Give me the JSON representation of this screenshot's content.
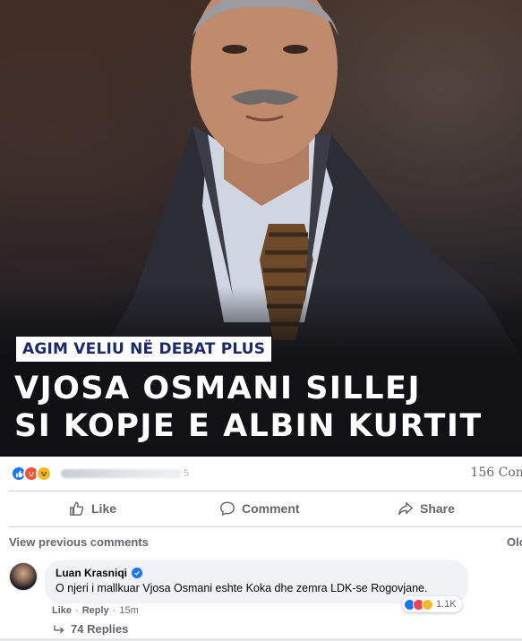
{
  "post": {
    "image": {
      "tag": "AGIM VELIU NË DEBAT PLUS",
      "headline_line1": "VJOSA OSMANI SILLEJ",
      "headline_line2": "SI KOPJE E ALBIN KURTIT"
    },
    "reactions": {
      "types": [
        "like-icon",
        "angry-icon",
        "haha-icon"
      ],
      "comments_count": "156 Com"
    },
    "actions": {
      "like_label": "Like",
      "comment_label": "Comment",
      "share_label": "Share"
    }
  },
  "comments": {
    "view_previous": "View previous comments",
    "sort_label": "Olc",
    "items": [
      {
        "author": "Luan Krasniqi",
        "verified": true,
        "text": "O njeri i mallkuar Vjosa Osmani eshte Koka dhe zemra LDK-se Rogovjane.",
        "reaction_count": "1.1K",
        "like_label": "Like",
        "reply_label": "Reply",
        "time": "15m",
        "replies_label": "74 Replies"
      }
    ]
  },
  "colors": {
    "brand_blue": "#1877f2",
    "tag_text": "#1b2a6b",
    "muted_text": "#65676b",
    "bubble_bg": "#f0f2f5"
  }
}
